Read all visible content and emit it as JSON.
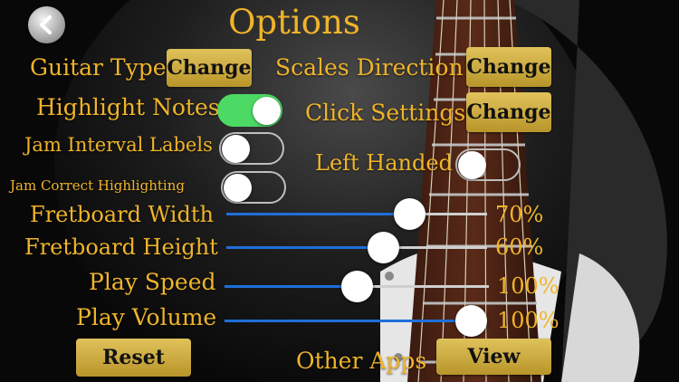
{
  "title": "Options",
  "back_icon": "back-arrow-icon",
  "colors": {
    "label": "#f0b429",
    "button": "#c9a53a",
    "toggle_on": "#4cd964",
    "slider_fill": "#1e6fd9"
  },
  "guitar_type": {
    "label": "Guitar Type",
    "button": "Change"
  },
  "scales_direction": {
    "label": "Scales Direction",
    "button": "Change"
  },
  "highlight_notes": {
    "label": "Highlight Notes",
    "on": true
  },
  "click_settings": {
    "label": "Click Settings",
    "button": "Change"
  },
  "jam_interval_labels": {
    "label": "Jam Interval Labels",
    "on": false
  },
  "left_handed": {
    "label": "Left Handed",
    "on": false
  },
  "jam_correct_highlighting": {
    "label": "Jam Correct Highlighting",
    "on": false
  },
  "fretboard_width": {
    "label": "Fretboard Width",
    "value": "70%",
    "level": 0.7
  },
  "fretboard_height": {
    "label": "Fretboard Height",
    "value": "60%",
    "level": 0.6
  },
  "play_speed": {
    "label": "Play Speed",
    "value": "100%",
    "level": 0.5
  },
  "play_volume": {
    "label": "Play Volume",
    "value": "100%",
    "level": 1.0
  },
  "reset": {
    "label": "Reset"
  },
  "other_apps": {
    "label": "Other Apps",
    "button": "View"
  }
}
